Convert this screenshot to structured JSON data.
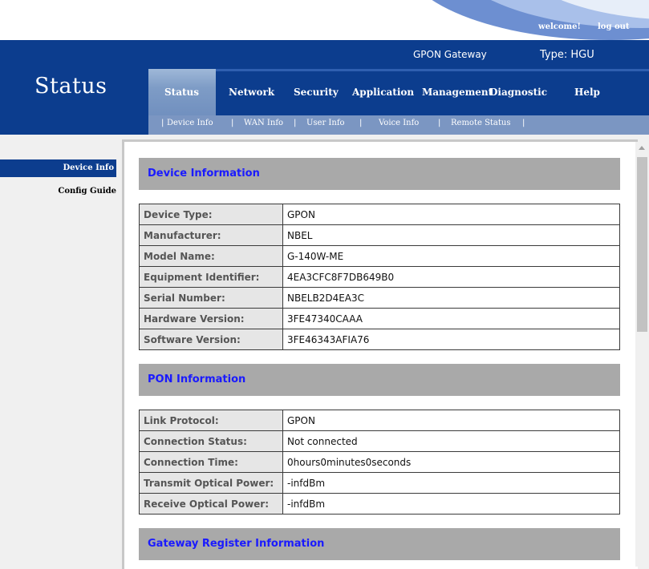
{
  "top": {
    "welcome": "welcome!",
    "logout": "log out"
  },
  "header": {
    "title": "Status",
    "gateway": "GPON Gateway",
    "type": "Type: HGU"
  },
  "menu": [
    "Status",
    "Network",
    "Security",
    "Application",
    "Management",
    "Diagnostic",
    "Help"
  ],
  "submenu": [
    "Device Info",
    "WAN Info",
    "User Info",
    "Voice Info",
    "Remote Status"
  ],
  "sidebar": [
    "Device Info",
    "Config Guide"
  ],
  "sections": {
    "device": {
      "title": "Device Information",
      "rows": [
        {
          "k": "Device Type:",
          "v": "GPON"
        },
        {
          "k": "Manufacturer:",
          "v": "NBEL"
        },
        {
          "k": "Model Name:",
          "v": "G-140W-ME"
        },
        {
          "k": "Equipment Identifier:",
          "v": "4EA3CFC8F7DB649B0"
        },
        {
          "k": "Serial Number:",
          "v": "NBELB2D4EA3C"
        },
        {
          "k": "Hardware Version:",
          "v": "3FE47340CAAA"
        },
        {
          "k": "Software Version:",
          "v": "3FE46343AFIA76"
        }
      ]
    },
    "pon": {
      "title": "PON Information",
      "rows": [
        {
          "k": "Link Protocol:",
          "v": "GPON"
        },
        {
          "k": "Connection Status:",
          "v": "Not connected"
        },
        {
          "k": "Connection Time:",
          "v": "0hours0minutes0seconds"
        },
        {
          "k": "Transmit Optical Power:",
          "v": "-infdBm"
        },
        {
          "k": "Receive Optical Power:",
          "v": "-infdBm"
        }
      ]
    },
    "gateway": {
      "title": "Gateway Register Information"
    }
  },
  "colors": {
    "header_blue": "#0c3d8e",
    "section_gray": "#a9a9a9",
    "section_title": "#1a1aff"
  }
}
